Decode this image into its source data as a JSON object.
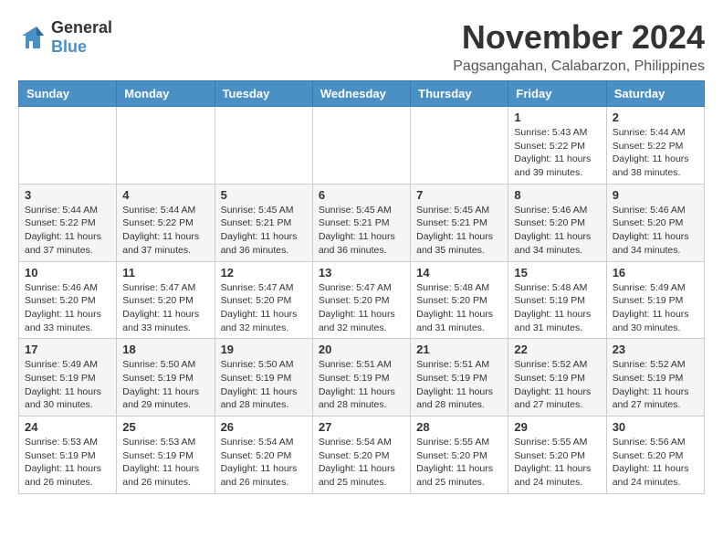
{
  "logo": {
    "general": "General",
    "blue": "Blue"
  },
  "header": {
    "month": "November 2024",
    "location": "Pagsangahan, Calabarzon, Philippines"
  },
  "weekdays": [
    "Sunday",
    "Monday",
    "Tuesday",
    "Wednesday",
    "Thursday",
    "Friday",
    "Saturday"
  ],
  "weeks": [
    [
      {
        "day": "",
        "info": ""
      },
      {
        "day": "",
        "info": ""
      },
      {
        "day": "",
        "info": ""
      },
      {
        "day": "",
        "info": ""
      },
      {
        "day": "",
        "info": ""
      },
      {
        "day": "1",
        "info": "Sunrise: 5:43 AM\nSunset: 5:22 PM\nDaylight: 11 hours and 39 minutes."
      },
      {
        "day": "2",
        "info": "Sunrise: 5:44 AM\nSunset: 5:22 PM\nDaylight: 11 hours and 38 minutes."
      }
    ],
    [
      {
        "day": "3",
        "info": "Sunrise: 5:44 AM\nSunset: 5:22 PM\nDaylight: 11 hours and 37 minutes."
      },
      {
        "day": "4",
        "info": "Sunrise: 5:44 AM\nSunset: 5:22 PM\nDaylight: 11 hours and 37 minutes."
      },
      {
        "day": "5",
        "info": "Sunrise: 5:45 AM\nSunset: 5:21 PM\nDaylight: 11 hours and 36 minutes."
      },
      {
        "day": "6",
        "info": "Sunrise: 5:45 AM\nSunset: 5:21 PM\nDaylight: 11 hours and 36 minutes."
      },
      {
        "day": "7",
        "info": "Sunrise: 5:45 AM\nSunset: 5:21 PM\nDaylight: 11 hours and 35 minutes."
      },
      {
        "day": "8",
        "info": "Sunrise: 5:46 AM\nSunset: 5:20 PM\nDaylight: 11 hours and 34 minutes."
      },
      {
        "day": "9",
        "info": "Sunrise: 5:46 AM\nSunset: 5:20 PM\nDaylight: 11 hours and 34 minutes."
      }
    ],
    [
      {
        "day": "10",
        "info": "Sunrise: 5:46 AM\nSunset: 5:20 PM\nDaylight: 11 hours and 33 minutes."
      },
      {
        "day": "11",
        "info": "Sunrise: 5:47 AM\nSunset: 5:20 PM\nDaylight: 11 hours and 33 minutes."
      },
      {
        "day": "12",
        "info": "Sunrise: 5:47 AM\nSunset: 5:20 PM\nDaylight: 11 hours and 32 minutes."
      },
      {
        "day": "13",
        "info": "Sunrise: 5:47 AM\nSunset: 5:20 PM\nDaylight: 11 hours and 32 minutes."
      },
      {
        "day": "14",
        "info": "Sunrise: 5:48 AM\nSunset: 5:20 PM\nDaylight: 11 hours and 31 minutes."
      },
      {
        "day": "15",
        "info": "Sunrise: 5:48 AM\nSunset: 5:19 PM\nDaylight: 11 hours and 31 minutes."
      },
      {
        "day": "16",
        "info": "Sunrise: 5:49 AM\nSunset: 5:19 PM\nDaylight: 11 hours and 30 minutes."
      }
    ],
    [
      {
        "day": "17",
        "info": "Sunrise: 5:49 AM\nSunset: 5:19 PM\nDaylight: 11 hours and 30 minutes."
      },
      {
        "day": "18",
        "info": "Sunrise: 5:50 AM\nSunset: 5:19 PM\nDaylight: 11 hours and 29 minutes."
      },
      {
        "day": "19",
        "info": "Sunrise: 5:50 AM\nSunset: 5:19 PM\nDaylight: 11 hours and 28 minutes."
      },
      {
        "day": "20",
        "info": "Sunrise: 5:51 AM\nSunset: 5:19 PM\nDaylight: 11 hours and 28 minutes."
      },
      {
        "day": "21",
        "info": "Sunrise: 5:51 AM\nSunset: 5:19 PM\nDaylight: 11 hours and 28 minutes."
      },
      {
        "day": "22",
        "info": "Sunrise: 5:52 AM\nSunset: 5:19 PM\nDaylight: 11 hours and 27 minutes."
      },
      {
        "day": "23",
        "info": "Sunrise: 5:52 AM\nSunset: 5:19 PM\nDaylight: 11 hours and 27 minutes."
      }
    ],
    [
      {
        "day": "24",
        "info": "Sunrise: 5:53 AM\nSunset: 5:19 PM\nDaylight: 11 hours and 26 minutes."
      },
      {
        "day": "25",
        "info": "Sunrise: 5:53 AM\nSunset: 5:19 PM\nDaylight: 11 hours and 26 minutes."
      },
      {
        "day": "26",
        "info": "Sunrise: 5:54 AM\nSunset: 5:20 PM\nDaylight: 11 hours and 26 minutes."
      },
      {
        "day": "27",
        "info": "Sunrise: 5:54 AM\nSunset: 5:20 PM\nDaylight: 11 hours and 25 minutes."
      },
      {
        "day": "28",
        "info": "Sunrise: 5:55 AM\nSunset: 5:20 PM\nDaylight: 11 hours and 25 minutes."
      },
      {
        "day": "29",
        "info": "Sunrise: 5:55 AM\nSunset: 5:20 PM\nDaylight: 11 hours and 24 minutes."
      },
      {
        "day": "30",
        "info": "Sunrise: 5:56 AM\nSunset: 5:20 PM\nDaylight: 11 hours and 24 minutes."
      }
    ]
  ]
}
